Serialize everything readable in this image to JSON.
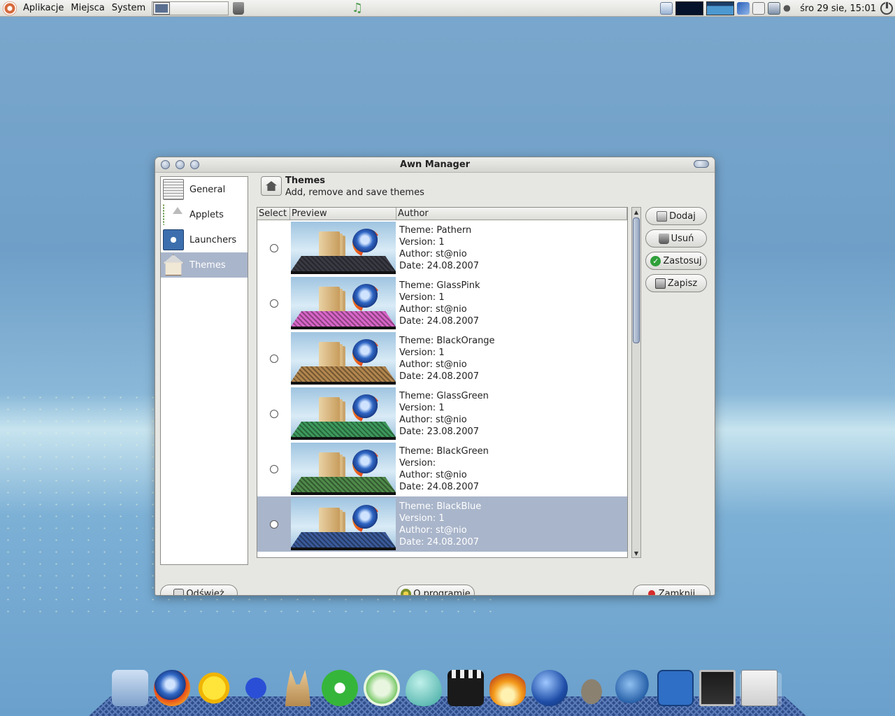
{
  "top_panel": {
    "menus": [
      "Aplikacje",
      "Miejsca",
      "System"
    ],
    "clock": "śro 29 sie, 15:01"
  },
  "window": {
    "title": "Awn Manager",
    "sidebar": [
      {
        "label": "General",
        "icon": "general-icon"
      },
      {
        "label": "Applets",
        "icon": "applets-icon"
      },
      {
        "label": "Launchers",
        "icon": "launchers-icon"
      },
      {
        "label": "Themes",
        "icon": "themes-icon",
        "active": true
      }
    ],
    "header": {
      "title": "Themes",
      "subtitle": "Add, remove and save themes"
    },
    "list_columns": [
      "Select",
      "Preview",
      "Author"
    ],
    "themes": [
      {
        "theme": "Theme: Pathern",
        "version": "Version: 1",
        "author": "Author: st@nio",
        "date": "Date: 24.08.2007",
        "dock_color": "#3a3a44",
        "selected": false
      },
      {
        "theme": "Theme: GlassPink",
        "version": "Version: 1",
        "author": "Author: st@nio",
        "date": "Date: 24.08.2007",
        "dock_color": "#d865c8",
        "selected": false
      },
      {
        "theme": "Theme: BlackOrange",
        "version": "Version: 1",
        "author": "Author: st@nio",
        "date": "Date: 24.08.2007",
        "dock_color": "#b2864e",
        "selected": false
      },
      {
        "theme": "Theme: GlassGreen",
        "version": "Version: 1",
        "author": "Author: st@nio",
        "date": "Date: 23.08.2007",
        "dock_color": "#3d9a5c",
        "selected": false
      },
      {
        "theme": "Theme: BlackGreen",
        "version": "Version:",
        "author": "Author: st@nio",
        "date": "Date: 24.08.2007",
        "dock_color": "#4f8a4a",
        "selected": false
      },
      {
        "theme": "Theme: BlackBlue",
        "version": "Version: 1",
        "author": "Author: st@nio",
        "date": "Date: 24.08.2007",
        "dock_color": "#3a5a9a",
        "selected": true
      }
    ],
    "actions": {
      "add": "Dodaj",
      "remove": "Usuń",
      "apply": "Zastosuj",
      "save": "Zapisz"
    },
    "bottom": {
      "refresh": "Odśwież",
      "about": "O programie",
      "close": "Zamknij"
    }
  },
  "dock_icons": [
    "folder-icon",
    "firefox-icon",
    "sun-icon",
    "frog-icon",
    "rabbit-icon",
    "skype-icon",
    "music-icon",
    "egg-icon",
    "clapper-icon",
    "flame-icon",
    "earth-icon",
    "gimp-icon",
    "bird-icon",
    "expand-icon",
    "terminal-icon",
    "awn-manager-icon"
  ]
}
